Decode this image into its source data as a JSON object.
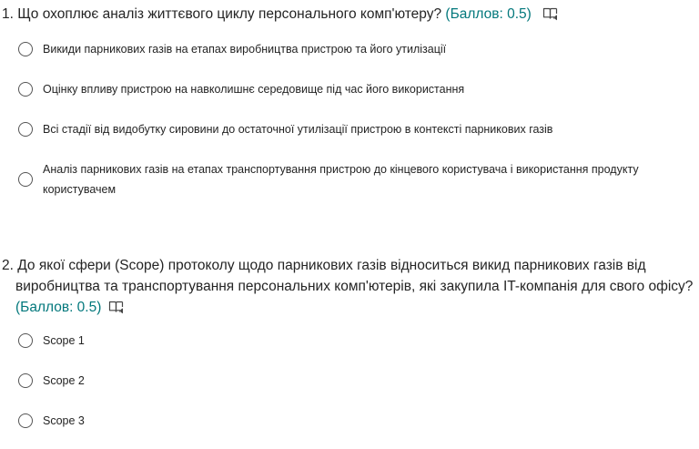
{
  "questions": [
    {
      "number": "1.",
      "text": "Що охоплює аналіз життєвого циклу персонального комп'ютеру?",
      "points": "(Баллов: 0.5)",
      "options": [
        "Викиди парникових газів на етапах виробництва пристрою та його утилізації",
        "Оцінку впливу пристрою на навколишнє середовище під час його використання",
        "Всі стадії від видобутку сировини до остаточної утилізації пристрою в контексті парникових газів",
        "Аналіз парникових газів на етапах  транспортування пристрою до кінцевого користувача і використання продукту користувачем"
      ]
    },
    {
      "number": "2.",
      "text_line1": "До якої сфери (Scope) протоколу щодо парникових газів відноситься викид парникових газів від",
      "text_line2": "виробництва та транспортування персональних комп'ютерів, які закупила IT-компанія для свого офісу?",
      "points": "(Баллов: 0.5)",
      "options": [
        "Scope 1",
        "Scope 2",
        "Scope 3"
      ]
    }
  ],
  "icons": {
    "reader": "immersive-reader-icon",
    "radio": "radio-button-icon"
  },
  "colors": {
    "points": "#03787c",
    "text": "#242424",
    "radio_border": "#555555"
  }
}
